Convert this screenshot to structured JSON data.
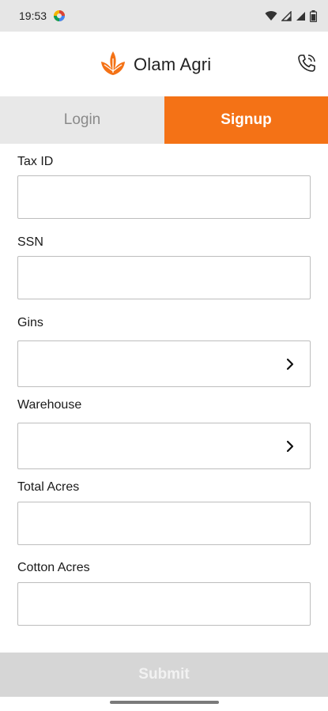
{
  "status_bar": {
    "time": "19:53",
    "app_icon": "multicolor-app-icon",
    "icons": [
      "wifi-icon",
      "cell-signal-icon",
      "cell-signal-icon",
      "battery-icon"
    ]
  },
  "header": {
    "brand_name": "Olam Agri",
    "logo_icon": "olam-leaf-logo",
    "call_icon": "phone-call-icon",
    "brand_color": "#f47216"
  },
  "tabs": [
    {
      "label": "Login",
      "active": false
    },
    {
      "label": "Signup",
      "active": true
    }
  ],
  "form": {
    "fields": [
      {
        "label": "Tax ID",
        "value": "",
        "type": "text"
      },
      {
        "label": "SSN",
        "value": "",
        "type": "text"
      },
      {
        "label": "Gins",
        "value": "",
        "type": "select"
      },
      {
        "label": "Warehouse",
        "value": "",
        "type": "select"
      },
      {
        "label": "Total Acres",
        "value": "",
        "type": "text"
      },
      {
        "label": "Cotton Acres",
        "value": "",
        "type": "text"
      }
    ]
  },
  "submit": {
    "label": "Submit",
    "enabled": false
  }
}
